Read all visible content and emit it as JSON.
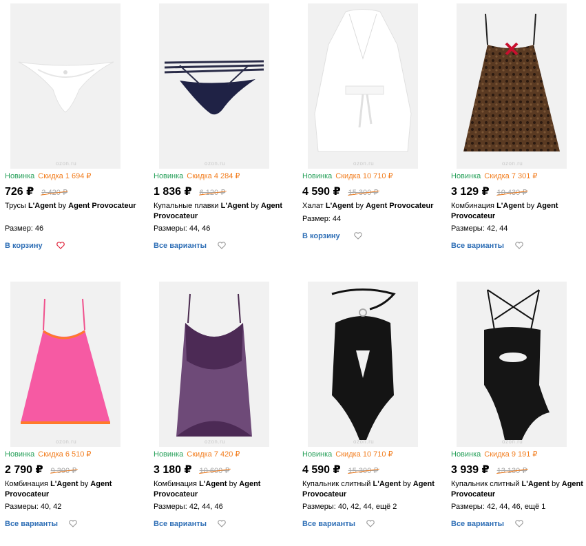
{
  "colors": {
    "new": "#27a05a",
    "discount": "#f27c1c",
    "link": "#2f6fb6",
    "heart_active": "#e0243c",
    "heart": "#999999"
  },
  "products": [
    {
      "badge_new": "Новинка",
      "badge_discount": "Скидка 1 694 ₽",
      "price": "726 ₽",
      "old_price": "2 420 ₽",
      "name_prefix": "Трусы ",
      "brand": "L'Agent",
      "by": " by ",
      "brand2": "Agent Provocateur",
      "sizes": "Размер: 46",
      "action": "В корзину",
      "favorite": true,
      "watermark": "ozon.ru"
    },
    {
      "badge_new": "Новинка",
      "badge_discount": "Скидка 4 284 ₽",
      "price": "1 836 ₽",
      "old_price": "6 120 ₽",
      "name_prefix": "Купальные плавки ",
      "brand": "L'Agent",
      "by": " by ",
      "brand2": "Agent Provocateur",
      "sizes": "Размеры: 44, 46",
      "action": "Все варианты",
      "favorite": false,
      "watermark": "ozon.ru"
    },
    {
      "badge_new": "Новинка",
      "badge_discount": "Скидка 10 710 ₽",
      "price": "4 590 ₽",
      "old_price": "15 300 ₽",
      "name_prefix": "Халат ",
      "brand": "L'Agent",
      "by": " by ",
      "brand2": "Agent Provocateur",
      "sizes": "Размер: 44",
      "action": "В корзину",
      "favorite": false,
      "watermark": "ozon.ru"
    },
    {
      "badge_new": "Новинка",
      "badge_discount": "Скидка 7 301 ₽",
      "price": "3 129 ₽",
      "old_price": "10 430 ₽",
      "name_prefix": "Комбинация ",
      "brand": "L'Agent",
      "by": " by ",
      "brand2": "Agent Provocateur",
      "sizes": "Размеры: 42, 44",
      "action": "Все варианты",
      "favorite": false,
      "watermark": "ozon.ru"
    },
    {
      "badge_new": "Новинка",
      "badge_discount": "Скидка 6 510 ₽",
      "price": "2 790 ₽",
      "old_price": "9 300 ₽",
      "name_prefix": "Комбинация ",
      "brand": "L'Agent",
      "by": " by ",
      "brand2": "Agent Provocateur",
      "sizes": "Размеры: 40, 42",
      "action": "Все варианты",
      "favorite": false,
      "watermark": "ozon.ru"
    },
    {
      "badge_new": "Новинка",
      "badge_discount": "Скидка 7 420 ₽",
      "price": "3 180 ₽",
      "old_price": "10 600 ₽",
      "name_prefix": "Комбинация ",
      "brand": "L'Agent",
      "by": " by ",
      "brand2": "Agent Provocateur",
      "sizes": "Размеры: 42, 44, 46",
      "action": "Все варианты",
      "favorite": false,
      "watermark": "ozon.ru"
    },
    {
      "badge_new": "Новинка",
      "badge_discount": "Скидка 10 710 ₽",
      "price": "4 590 ₽",
      "old_price": "15 300 ₽",
      "name_prefix": "Купальник слитный ",
      "brand": "L'Agent",
      "by": " by ",
      "brand2": "Agent Provocateur",
      "sizes": "Размеры: 40, 42, 44, ещё 2",
      "action": "Все варианты",
      "favorite": false,
      "watermark": "ozon.ru"
    },
    {
      "badge_new": "Новинка",
      "badge_discount": "Скидка 9 191 ₽",
      "price": "3 939 ₽",
      "old_price": "13 130 ₽",
      "name_prefix": "Купальник слитный ",
      "brand": "L'Agent",
      "by": " by ",
      "brand2": "Agent Provocateur",
      "sizes": "Размеры: 42, 44, 46, ещё 1",
      "action": "Все варианты",
      "favorite": false,
      "watermark": "ozon.ru"
    }
  ]
}
